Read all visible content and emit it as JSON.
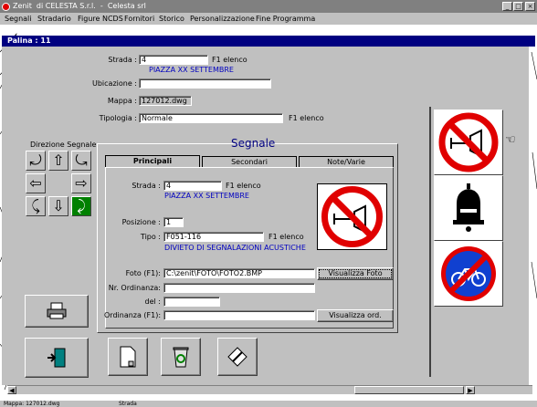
{
  "window": {
    "title": "Zenit  di CELESTA S.r.l.  -  Celesta srl"
  },
  "menu": [
    "Segnali",
    "Stradario",
    "Figure NCDS",
    "Fornitori",
    "Storico",
    "Personalizzazione",
    "Fine Programma"
  ],
  "document": {
    "title": "Palina : 11"
  },
  "palina": {
    "strada_label": "Strada :",
    "strada_value": "4",
    "strada_hint": "F1 elenco",
    "strada_name": "PIAZZA XX SETTEMBRE",
    "ubicazione_label": "Ubicazione :",
    "ubicazione_value": "",
    "mappa_label": "Mappa :",
    "mappa_value": "127012.dwg",
    "tipologia_label": "Tipologia :",
    "tipologia_value": "Normale",
    "tipologia_hint": "F1 elenco"
  },
  "direzione": {
    "label": "Direzione Segnale"
  },
  "segnale": {
    "title": "Segnale",
    "tabs": [
      "Principali",
      "Secondari",
      "Note/Varie"
    ],
    "strada_label": "Strada :",
    "strada_value": "4",
    "strada_hint": "F1 elenco",
    "strada_name": "PIAZZA XX SETTEMBRE",
    "posizione_label": "Posizione :",
    "posizione_value": "1",
    "tipo_label": "Tipo :",
    "tipo_value": "F051-116",
    "tipo_hint": "F1 elenco",
    "tipo_name": "DIVIETO DI SEGNALAZIONI ACUSTICHE",
    "foto_label": "Foto (F1):",
    "foto_value": "C:\\zenit\\FOTO\\FOTO2.BMP",
    "foto_button": "Visualizza Foto",
    "ordinanza_nr_label": "Nr. Ordinanza:",
    "ordinanza_nr_value": "",
    "del_label": "del :",
    "del_value": "",
    "ordinanza_label": "Ordinanza (F1):",
    "ordinanza_value": "",
    "ordinanza_button": "Visualizza ord."
  },
  "status": {
    "mappa": "Mappa: 127012.dwg",
    "strada": "Strada"
  },
  "colors": {
    "title_blue": "#000080",
    "sign_red": "#e00000",
    "sign_blue": "#1040d0",
    "highlight_green": "#008000"
  }
}
